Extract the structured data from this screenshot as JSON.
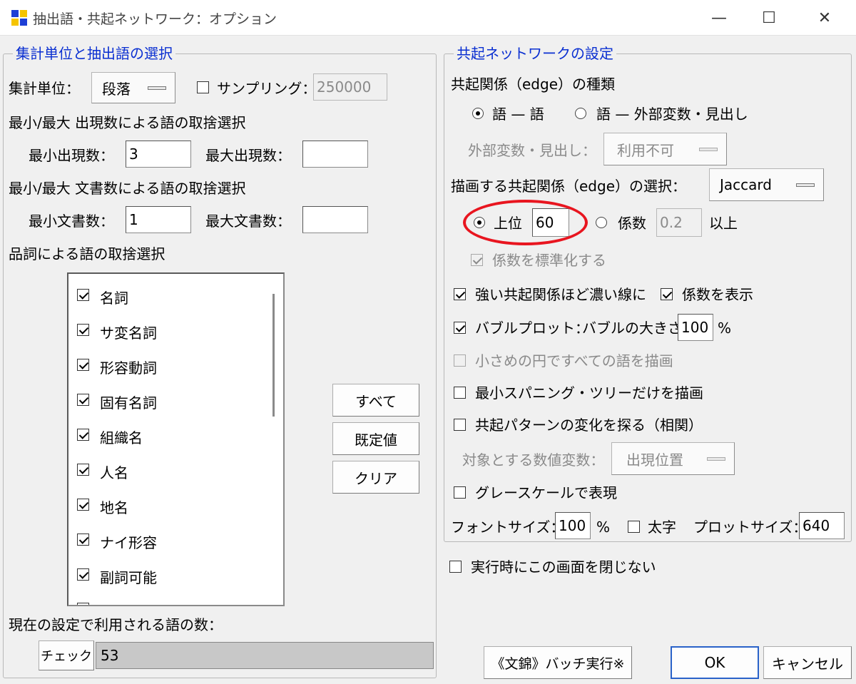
{
  "window": {
    "title": "抽出語・共起ネットワーク：オプション",
    "minimize": "—",
    "maximize": "☐",
    "close": "✕"
  },
  "left": {
    "group_title": "集計単位と抽出語の選択",
    "unit_label": "集計単位：",
    "unit_value": "段落",
    "sampling_label": "サンプリング：",
    "sampling_checked": false,
    "sampling_value": "250000",
    "freq_heading": "最小/最大 出現数による語の取捨選択",
    "min_freq_label": "最小出現数：",
    "min_freq_value": "3",
    "max_freq_label": "最大出現数：",
    "max_freq_value": "",
    "doc_heading": "最小/最大 文書数による語の取捨選択",
    "min_doc_label": "最小文書数：",
    "min_doc_value": "1",
    "max_doc_label": "最大文書数：",
    "max_doc_value": "",
    "pos_heading": "品詞による語の取捨選択",
    "pos_items": [
      {
        "label": "名詞",
        "checked": true
      },
      {
        "label": "サ変名詞",
        "checked": true
      },
      {
        "label": "形容動詞",
        "checked": true
      },
      {
        "label": "固有名詞",
        "checked": true
      },
      {
        "label": "組織名",
        "checked": true
      },
      {
        "label": "人名",
        "checked": true
      },
      {
        "label": "地名",
        "checked": true
      },
      {
        "label": "ナイ形容",
        "checked": true
      },
      {
        "label": "副詞可能",
        "checked": true
      }
    ],
    "btn_all": "すべて",
    "btn_default": "既定値",
    "btn_clear": "クリア",
    "count_label": "現在の設定で利用される語の数：",
    "check_button": "チェック",
    "count_value": "53"
  },
  "right": {
    "group_title": "共起ネットワークの設定",
    "edge_type_label": "共起関係（edge）の種類",
    "radio_word_word": "語 — 語",
    "radio_word_var": "語 — 外部変数・見出し",
    "ext_var_label": "外部変数・見出し：",
    "ext_var_value": "利用不可",
    "edge_select_label": "描画する共起関係（edge）の選択：",
    "edge_select_value": "Jaccard",
    "top_label": "上位",
    "top_value": "60",
    "coef_label": "係数",
    "coef_value": "0.2",
    "coef_suffix": "以上",
    "standardize_label": "係数を標準化する",
    "strong_label": "強い共起関係ほど濃い線に",
    "show_coef_label": "係数を表示",
    "bubble_label": "バブルプロット：",
    "bubble_size_label": "バブルの大きさ",
    "bubble_size_value": "100",
    "bubble_unit": "%",
    "small_circle_label": "小さめの円ですべての語を描画",
    "mst_label": "最小スパニング・ツリーだけを描画",
    "pattern_label": "共起パターンの変化を探る（相関）",
    "target_var_label": "対象とする数値変数：",
    "target_var_value": "出現位置",
    "grayscale_label": "グレースケールで表現",
    "font_size_label": "フォントサイズ：",
    "font_size_value": "100",
    "font_size_unit": "%",
    "bold_label": "太字",
    "plot_size_label": "プロットサイズ：",
    "plot_size_value": "640"
  },
  "bottom": {
    "keep_open_label": "実行時にこの画面を閉じない",
    "batch_button": "《文錦》バッチ実行※",
    "ok_button": "OK",
    "cancel_button": "キャンセル"
  },
  "colors": {
    "legend": "#0a2fd1",
    "annotation": "#e8151f"
  }
}
